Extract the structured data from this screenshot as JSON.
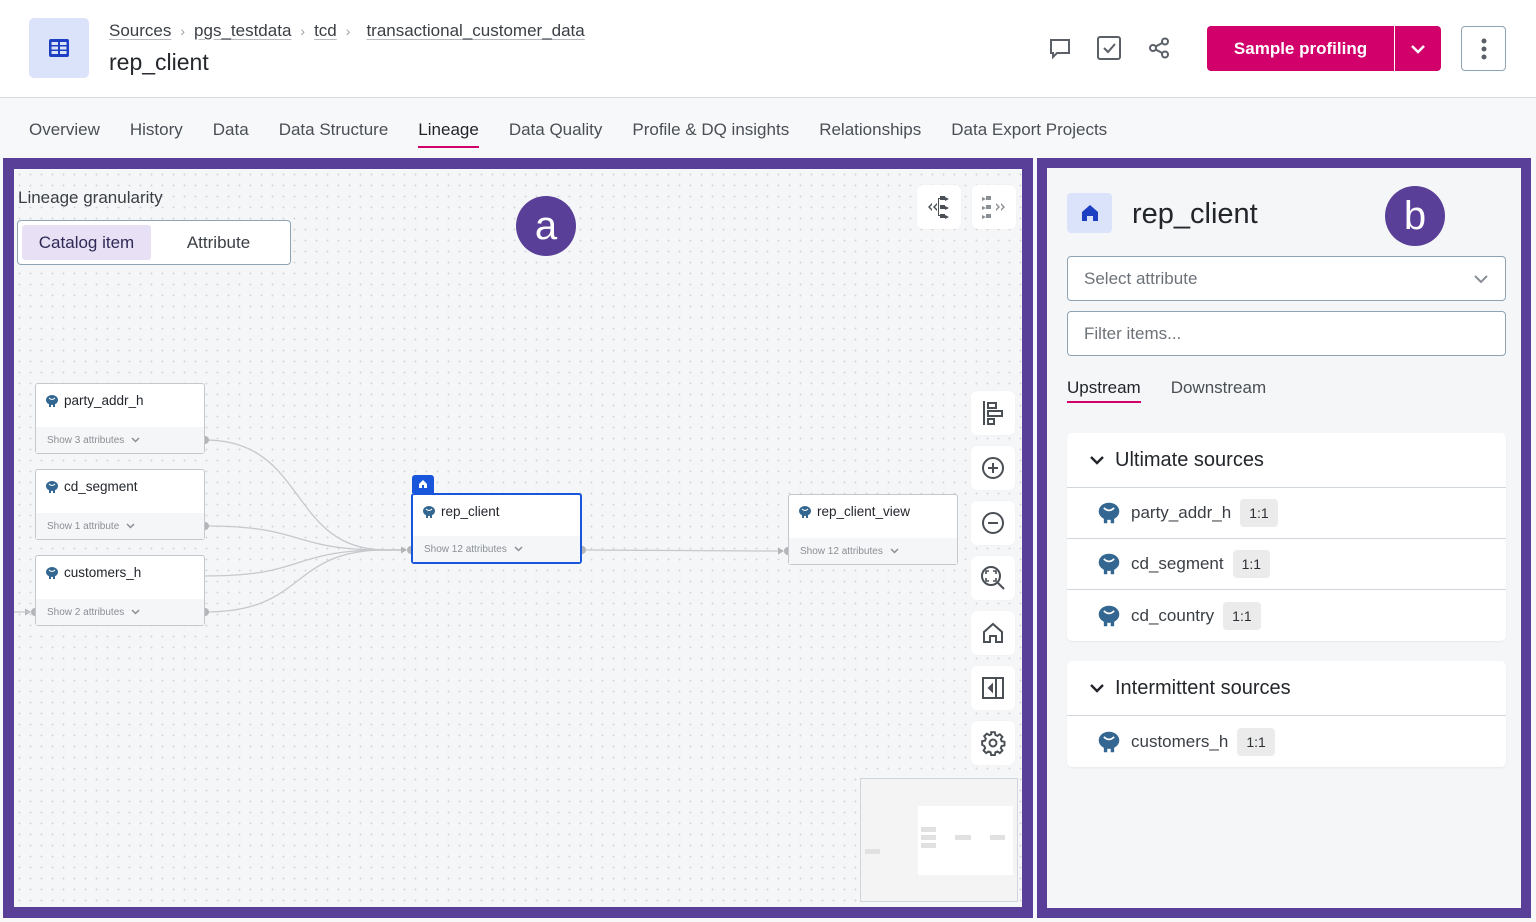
{
  "header": {
    "breadcrumb": [
      "Sources",
      "pgs_testdata",
      "tcd",
      "transactional_customer_data"
    ],
    "title": "rep_client",
    "icons": [
      "comment-icon",
      "task-checkbox-icon",
      "share-icon"
    ],
    "primary_button": "Sample profiling",
    "more_icon": "more-vertical-icon"
  },
  "tabs": [
    "Overview",
    "History",
    "Data",
    "Data Structure",
    "Lineage",
    "Data Quality",
    "Profile & DQ insights",
    "Relationships",
    "Data Export Projects"
  ],
  "active_tab": "Lineage",
  "lineage": {
    "annotation": "a",
    "granularity_label": "Lineage granularity",
    "granularity_options": [
      "Catalog item",
      "Attribute"
    ],
    "granularity_selected": "Catalog item",
    "nodes": [
      {
        "id": "party_addr_h",
        "name": "party_addr_h",
        "footer": "Show 3 attributes"
      },
      {
        "id": "cd_segment",
        "name": "cd_segment",
        "footer": "Show 1 attribute"
      },
      {
        "id": "customers_h",
        "name": "customers_h",
        "footer": "Show 2 attributes"
      },
      {
        "id": "rep_client",
        "name": "rep_client",
        "footer": "Show 12 attributes",
        "selected": true
      },
      {
        "id": "rep_client_view",
        "name": "rep_client_view",
        "footer": "Show 12 attributes"
      }
    ],
    "edges": [
      [
        "party_addr_h",
        "rep_client"
      ],
      [
        "cd_segment",
        "rep_client"
      ],
      [
        "customers_h",
        "rep_client"
      ],
      [
        "customers_h",
        "rep_client"
      ],
      [
        "rep_client",
        "rep_client_view"
      ]
    ],
    "toolbar_top": [
      "expand-upstream-icon",
      "expand-downstream-icon"
    ],
    "toolbar_side": [
      "auto-layout-icon",
      "zoom-in-icon",
      "zoom-out-icon",
      "fit-view-icon",
      "home-icon",
      "collapse-panel-icon",
      "settings-icon"
    ]
  },
  "details": {
    "annotation": "b",
    "title": "rep_client",
    "select_placeholder": "Select attribute",
    "filter_placeholder": "Filter items...",
    "tabs": [
      "Upstream",
      "Downstream"
    ],
    "active_tab": "Upstream",
    "groups": [
      {
        "title": "Ultimate sources",
        "items": [
          {
            "name": "party_addr_h",
            "ratio": "1:1"
          },
          {
            "name": "cd_segment",
            "ratio": "1:1"
          },
          {
            "name": "cd_country",
            "ratio": "1:1"
          }
        ]
      },
      {
        "title": "Intermittent sources",
        "items": [
          {
            "name": "customers_h",
            "ratio": "1:1"
          }
        ]
      }
    ]
  },
  "colors": {
    "accent": "#d1006a",
    "annotation": "#5a3f99",
    "selected_node": "#1a56db"
  }
}
